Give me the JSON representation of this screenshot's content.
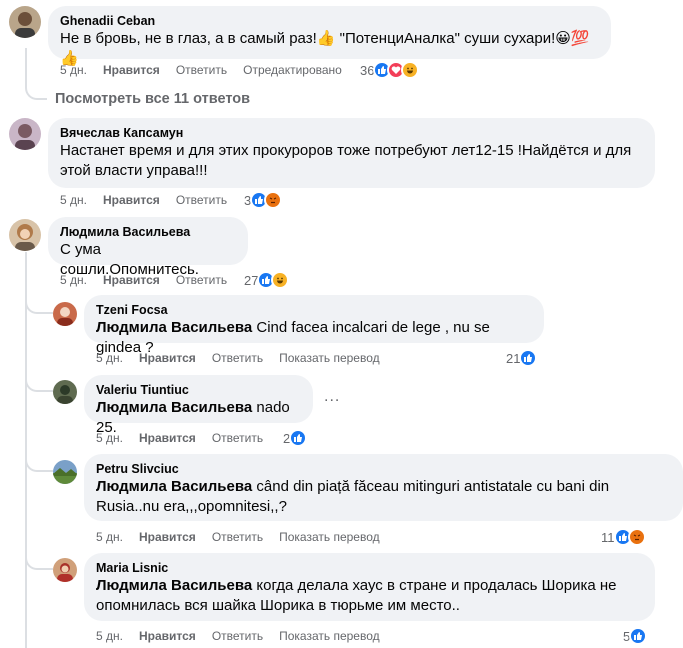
{
  "comments": [
    {
      "author": "Ghenadii Ceban",
      "text": "Не в бровь, не в глаз, а в самый раз!👍 \"ПотенциАналка\" суши сухари!😀💯👍",
      "time": "5 дн.",
      "like": "Нравится",
      "reply": "Ответить",
      "edited": "Отредактировано",
      "reaction_count": "36",
      "reactions": [
        "like",
        "love",
        "haha"
      ]
    },
    {
      "author": "Вячеслав Капсамун",
      "text_line1": "Настанет время и для этих прокуроров тоже потребуют лет12-15 !Найдётся и для",
      "text_line2": "этой власти управа!!!",
      "time": "5 дн.",
      "like": "Нравится",
      "reply": "Ответить",
      "reaction_count": "3",
      "reactions": [
        "like",
        "angry"
      ]
    },
    {
      "author": "Людмила Васильева",
      "text": "С ума сошли.Опомнитесь.",
      "time": "5 дн.",
      "like": "Нравится",
      "reply": "Ответить",
      "reaction_count": "27",
      "reactions": [
        "like",
        "haha"
      ]
    }
  ],
  "view_all_replies": "Посмотреть все 11 ответов",
  "replies": [
    {
      "author": "Tzeni Focsa",
      "mention": "Людмила Васильева",
      "text": " Cind facea incalcari de lege , nu se gindea ?",
      "time": "5 дн.",
      "like": "Нравится",
      "reply": "Ответить",
      "translate": "Показать перевод",
      "reaction_count": "21",
      "reactions": [
        "like"
      ]
    },
    {
      "author": "Valeriu Tiuntiuc",
      "mention": "Людмила Васильева",
      "text": " nado 25.",
      "time": "5 дн.",
      "like": "Нравится",
      "reply": "Ответить",
      "reaction_count": "2",
      "reactions": [
        "like"
      ],
      "more": "..."
    },
    {
      "author": "Petru Slivciuc",
      "mention": "Людмила Васильева",
      "text_line1": " când din piață făceau mitinguri antistatale cu bani din",
      "text_line2": "Rusia..nu era,,,opomnitesi,,?",
      "time": "5 дн.",
      "like": "Нравится",
      "reply": "Ответить",
      "translate": "Показать перевод",
      "reaction_count": "11",
      "reactions": [
        "like",
        "angry"
      ]
    },
    {
      "author": "Maria Lisnic",
      "mention": "Людмила Васильева",
      "text_line1": " когда делала хаус в стране и продалась Шорика не",
      "text_line2": "опомнилась вся шайка Шорика в тюрьме им место..",
      "time": "5 дн.",
      "like": "Нравится",
      "reply": "Ответить",
      "translate": "Показать перевод",
      "reaction_count": "5",
      "reactions": [
        "like"
      ]
    }
  ],
  "colors": {
    "bubble": "#f0f2f5",
    "meta": "#65676b",
    "like": "#1877f2",
    "love": "#f33e58",
    "haha": "#f7b125",
    "angry": "#e9710f"
  }
}
